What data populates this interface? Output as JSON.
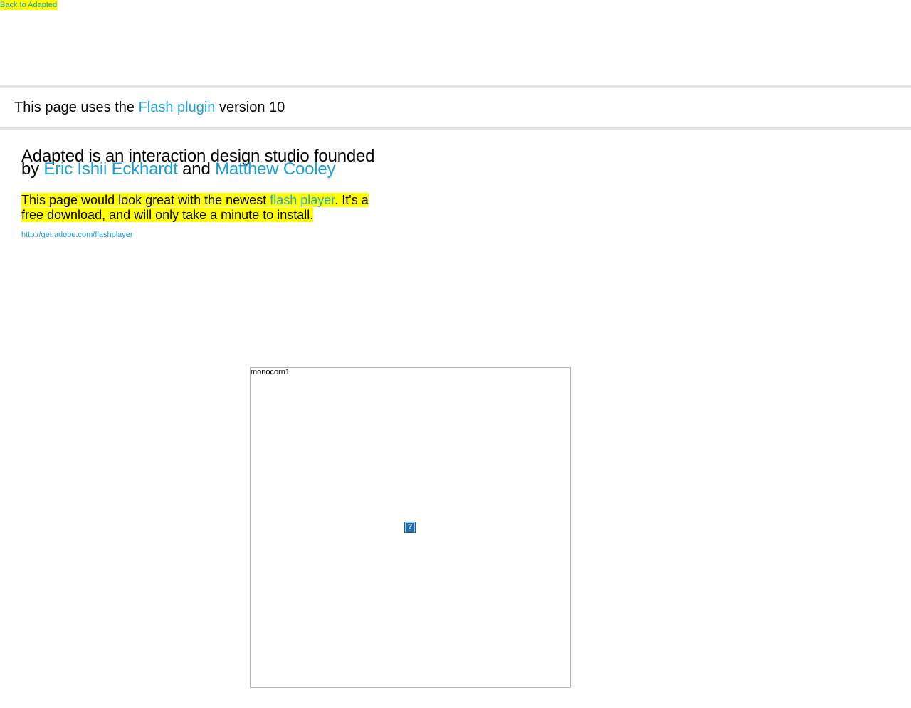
{
  "nav": {
    "back_label": "Back to Adapted"
  },
  "flash_bar": {
    "prefix": "This page uses the ",
    "link": "Flash plugin",
    "suffix": " version 10"
  },
  "intro": {
    "line1": "Adapted is an interaction design studio founded",
    "by": "by ",
    "founder1": "Eric Ishii Eckhardt",
    "and": " and ",
    "founder2": "Matthew Cooley"
  },
  "notice": {
    "prefix": "This page would look great with the newest ",
    "link": "flash player",
    "suffix": ". It's a free download, and will only take a minute to install."
  },
  "download_url": "http://get.adobe.com/flashplayer",
  "flash_object": {
    "label": "monocorn1",
    "icon_glyph": "?"
  },
  "colors": {
    "link": "#1a9ed4",
    "highlight": "#ffff00"
  }
}
